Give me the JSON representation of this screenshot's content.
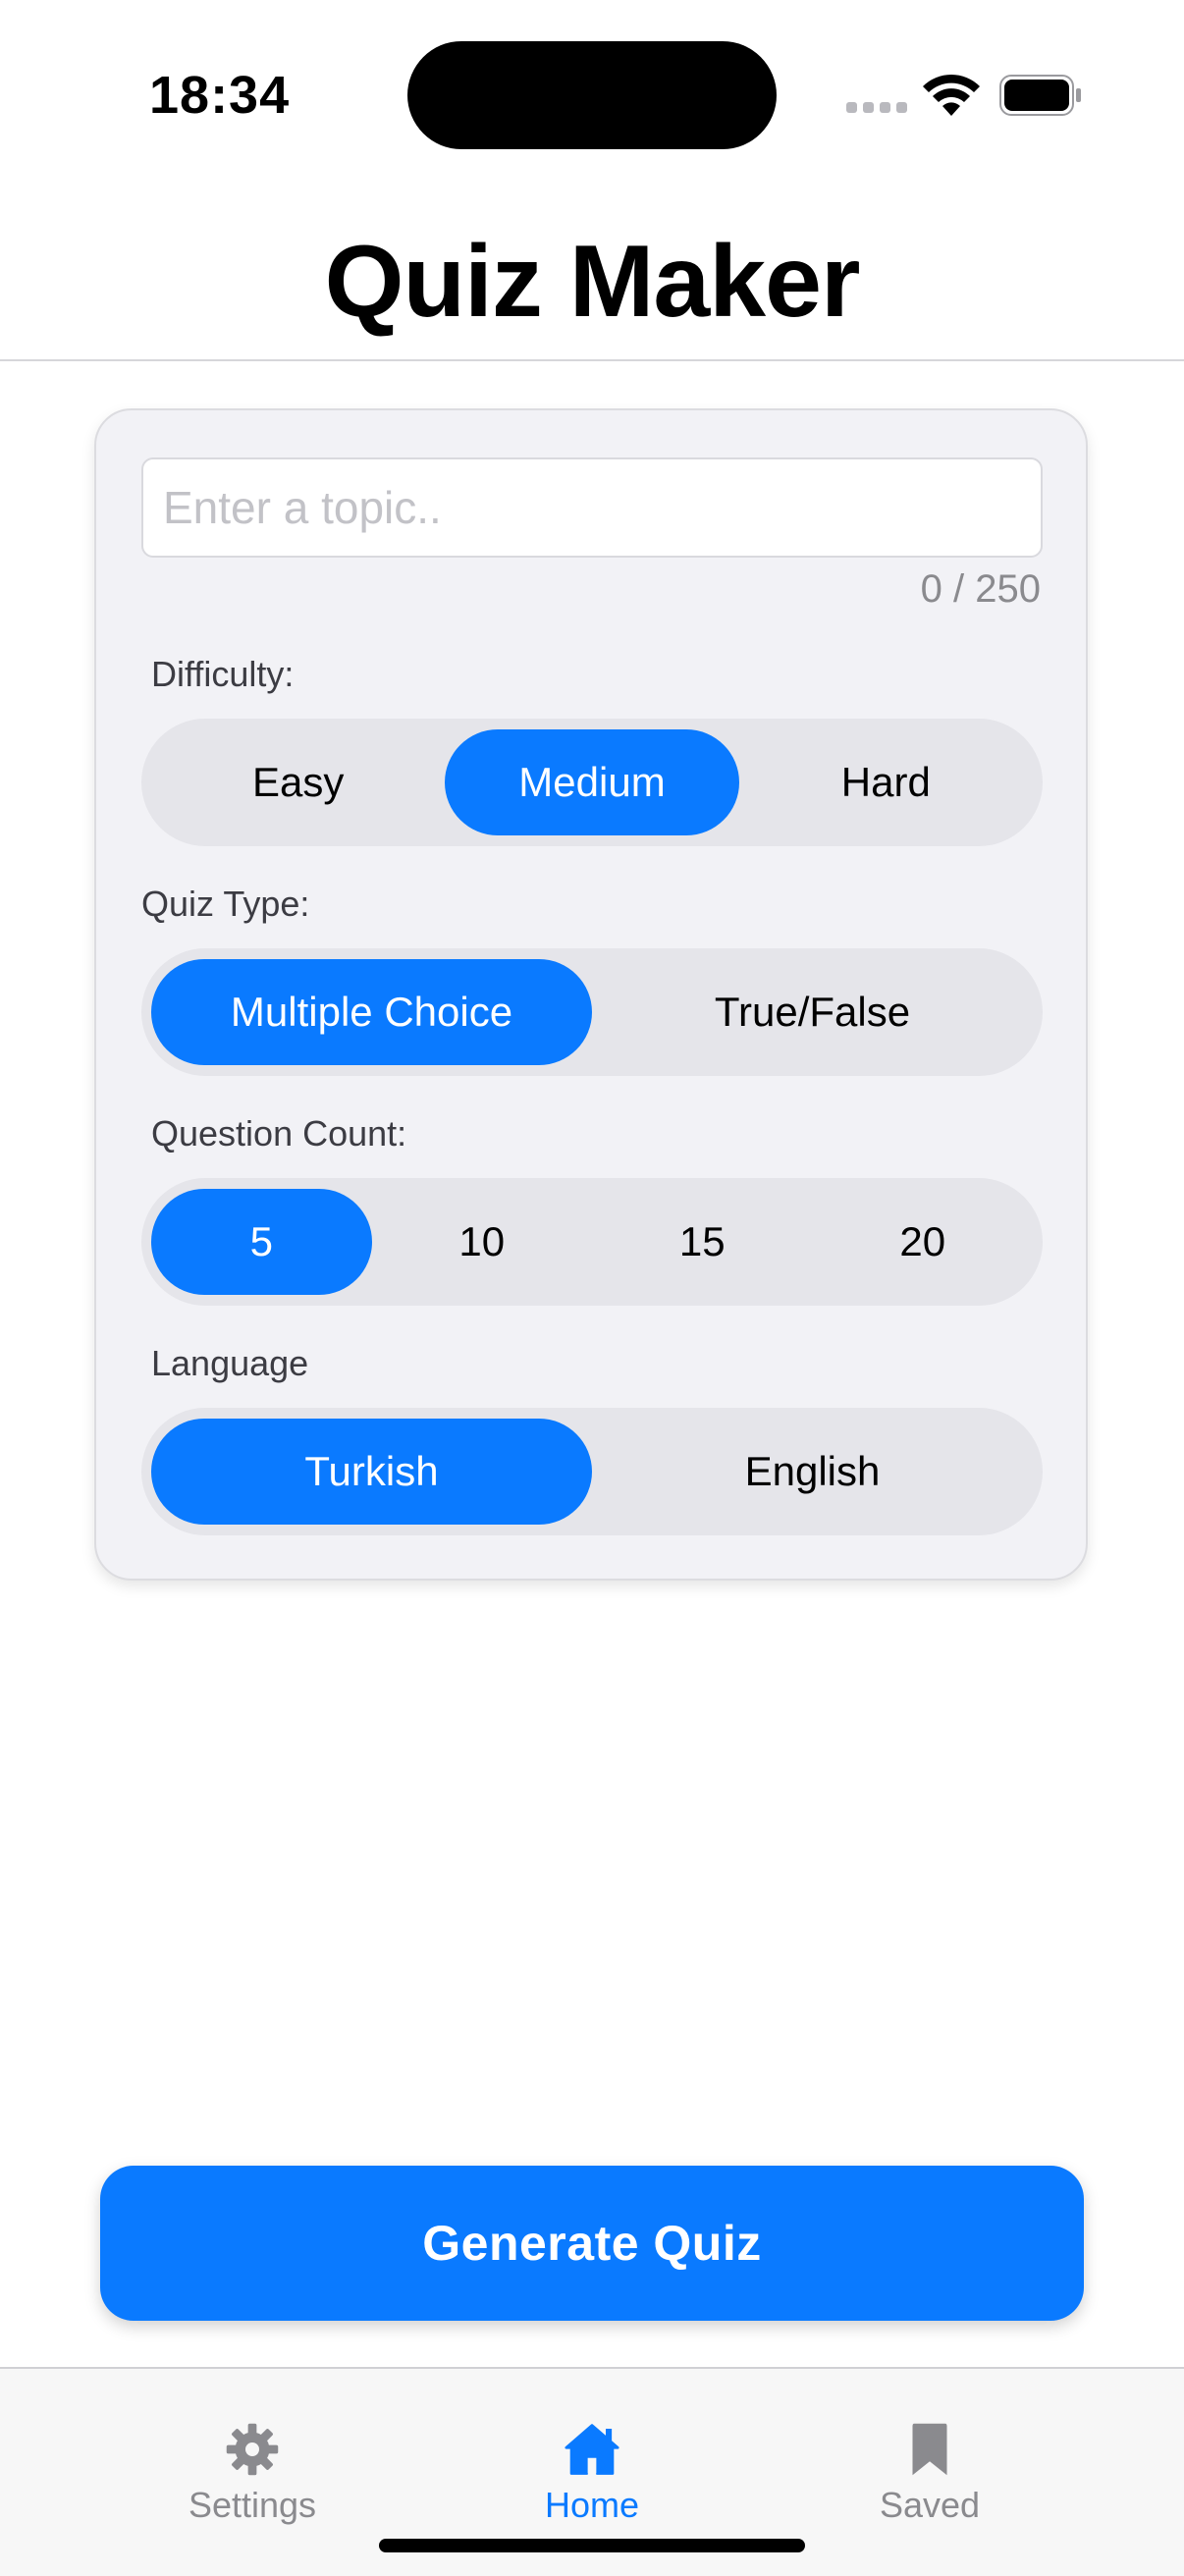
{
  "status_bar": {
    "time": "18:34"
  },
  "header": {
    "title": "Quiz Maker"
  },
  "form": {
    "topic": {
      "value": "",
      "placeholder": "Enter a topic..",
      "char_count": "0 / 250"
    },
    "difficulty": {
      "label": "Difficulty:",
      "options": [
        "Easy",
        "Medium",
        "Hard"
      ],
      "selected": "Medium"
    },
    "quiz_type": {
      "label": "Quiz Type:",
      "options": [
        "Multiple Choice",
        "True/False"
      ],
      "selected": "Multiple Choice"
    },
    "question_count": {
      "label": "Question Count:",
      "options": [
        "5",
        "10",
        "15",
        "20"
      ],
      "selected": "5"
    },
    "language": {
      "label": "Language",
      "options": [
        "Turkish",
        "English"
      ],
      "selected": "Turkish"
    }
  },
  "actions": {
    "generate_label": "Generate Quiz"
  },
  "tab_bar": {
    "items": [
      {
        "label": "Settings",
        "icon": "gear-icon",
        "active": false
      },
      {
        "label": "Home",
        "icon": "house-icon",
        "active": true
      },
      {
        "label": "Saved",
        "icon": "bookmark-icon",
        "active": false
      }
    ]
  },
  "colors": {
    "accent": "#0a7aff",
    "segment_bg": "#e5e5ea",
    "card_bg": "#f2f2f6",
    "inactive_tab": "#8a8a8e"
  }
}
